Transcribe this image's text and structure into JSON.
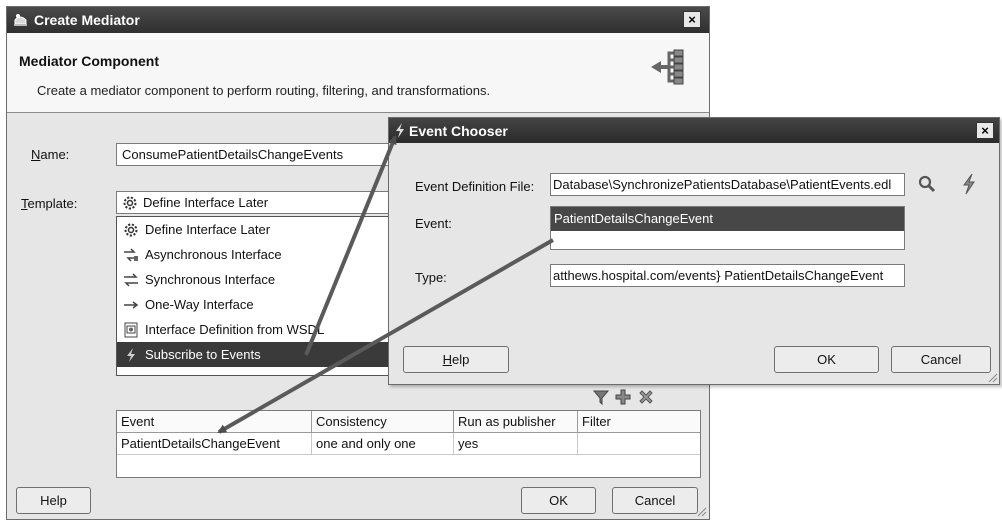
{
  "mediator": {
    "window_title": "Create Mediator",
    "close_glyph": "×",
    "header_title": "Mediator Component",
    "header_description": "Create a mediator component to perform routing, filtering, and transformations.",
    "name_label_key": "N",
    "name_label_rest": "ame:",
    "name_value": "ConsumePatientDetailsChangeEvents",
    "template_label_key": "T",
    "template_label_rest": "emplate:",
    "template_selected": "Define Interface Later",
    "template_options": [
      {
        "label": "Define Interface Later",
        "icon": "gear-icon"
      },
      {
        "label": "Asynchronous Interface",
        "icon": "async-interface-icon"
      },
      {
        "label": "Synchronous Interface",
        "icon": "sync-interface-icon"
      },
      {
        "label": "One-Way Interface",
        "icon": "one-way-arrow-icon"
      },
      {
        "label": "Interface Definition from WSDL",
        "icon": "wsdl-document-icon"
      },
      {
        "label": "Subscribe to Events",
        "icon": "lightning-icon",
        "selected": true
      }
    ],
    "table": {
      "headers": [
        "Event",
        "Consistency",
        "Run as publisher",
        "Filter"
      ],
      "rows": [
        [
          "PatientDetailsChangeEvent",
          "one and only one",
          "yes",
          ""
        ]
      ]
    },
    "help_label": "Help",
    "ok_label": "OK",
    "cancel_label": "Cancel"
  },
  "chooser": {
    "window_title": "Event Chooser",
    "close_glyph": "×",
    "edl_label": "Event Definition File:",
    "edl_value": "Database\\SynchronizePatientsDatabase\\PatientEvents.edl",
    "event_label": "Event:",
    "event_selected": "PatientDetailsChangeEvent",
    "type_label": "Type:",
    "type_value": "atthews.hospital.com/events} PatientDetailsChangeEvent",
    "help_key": "H",
    "help_rest": "elp",
    "ok_label": "OK",
    "cancel_label": "Cancel"
  },
  "colors": {
    "dialog_bg": "#e6e6e6",
    "titlebar": "#333333",
    "selection": "#3a3a3a",
    "arrow": "#555555"
  }
}
